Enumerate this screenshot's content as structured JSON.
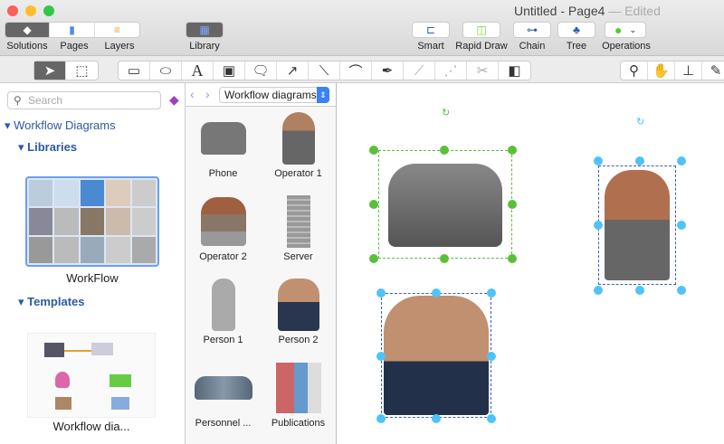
{
  "window": {
    "title": "Untitled - Page4",
    "status": "— Edited"
  },
  "toolbar": {
    "solutions": "Solutions",
    "pages": "Pages",
    "layers": "Layers",
    "library": "Library",
    "smart": "Smart",
    "rapid_draw": "Rapid Draw",
    "chain": "Chain",
    "tree": "Tree",
    "operations": "Operations"
  },
  "left": {
    "search_placeholder": "Search",
    "section": "Workflow Diagrams",
    "libraries": "Libraries",
    "library_name": "WorkFlow",
    "templates": "Templates",
    "template_name": "Workflow dia..."
  },
  "library": {
    "dropdown": "Workflow diagrams",
    "items": [
      "Phone",
      "Operator 1",
      "Operator 2",
      "Server",
      "Person 1",
      "Person 2",
      "Personnel ...",
      "Publications"
    ]
  },
  "colors": {
    "accent": "#2c5aa0",
    "selection_green": "#5cbf3a",
    "selection_blue": "#4fc3f7"
  }
}
